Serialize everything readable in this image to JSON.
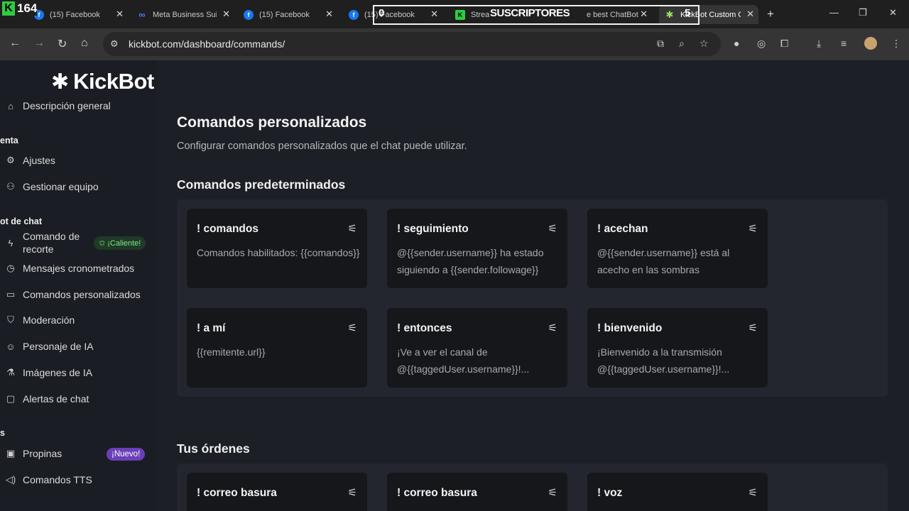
{
  "browser": {
    "tabs": [
      {
        "title": "(15) Facebook",
        "icon": "facebook-icon"
      },
      {
        "title": "Meta Business Sui",
        "icon": "meta-icon"
      },
      {
        "title": "(15) Facebook",
        "icon": "facebook-icon"
      },
      {
        "title": "(15) Facebook",
        "icon": "facebook-icon"
      },
      {
        "title": "Strea",
        "icon": "kick-icon"
      },
      {
        "title": "e best ChatBot",
        "icon": ""
      },
      {
        "title": "KickBot Custom C",
        "icon": "kickbot-icon"
      }
    ],
    "url": "kickbot.com/dashboard/commands/"
  },
  "overlay": {
    "counter": "164",
    "subs_left": "0",
    "subs_label": "SUSCRIPTORES",
    "subs_right": "5"
  },
  "sidebar": {
    "logo": "KickBot",
    "overview": "Descripción general",
    "section_tools": "enta",
    "settings": "Ajustes",
    "team": "Gestionar equipo",
    "section_chatbot": "ot de chat",
    "clip_command_line1": "Comando de",
    "clip_command_line2": "recorte",
    "badge_hot": "✩ ¡Caliente!",
    "timed_messages": "Mensajes cronometrados",
    "custom_commands": "Comandos personalizados",
    "moderation": "Moderación",
    "ai_character": "Personaje de IA",
    "ai_images": "Imágenes de IA",
    "chat_alerts": "Alertas de chat",
    "section_s": "s",
    "tips": "Propinas",
    "badge_new": "¡Nuevo!",
    "tts": "Comandos TTS"
  },
  "main": {
    "title": "Comandos personalizados",
    "subtitle": "Configurar comandos personalizados que el chat puede utilizar.",
    "default_heading": "Comandos predeterminados",
    "default_commands": [
      {
        "name": "! comandos",
        "body": "Comandos habilitados: {{comandos}}"
      },
      {
        "name": "! seguimiento",
        "body": "@{{sender.username}} ha estado siguiendo a {{sender.followage}}"
      },
      {
        "name": "! acechan",
        "body": "@{{sender.username}} está al acecho en las sombras"
      },
      {
        "name": "! a mí",
        "body": "{{remitente.url}}"
      },
      {
        "name": "! entonces",
        "body": "¡Ve a ver el canal de @{{taggedUser.username}}!..."
      },
      {
        "name": "! bienvenido",
        "body": "¡Bienvenido a la transmisión @{{taggedUser.username}}!..."
      }
    ],
    "your_heading": "Tus órdenes",
    "your_commands": [
      {
        "name": "! correo basura"
      },
      {
        "name": "! correo basura"
      },
      {
        "name": "! voz"
      }
    ]
  }
}
